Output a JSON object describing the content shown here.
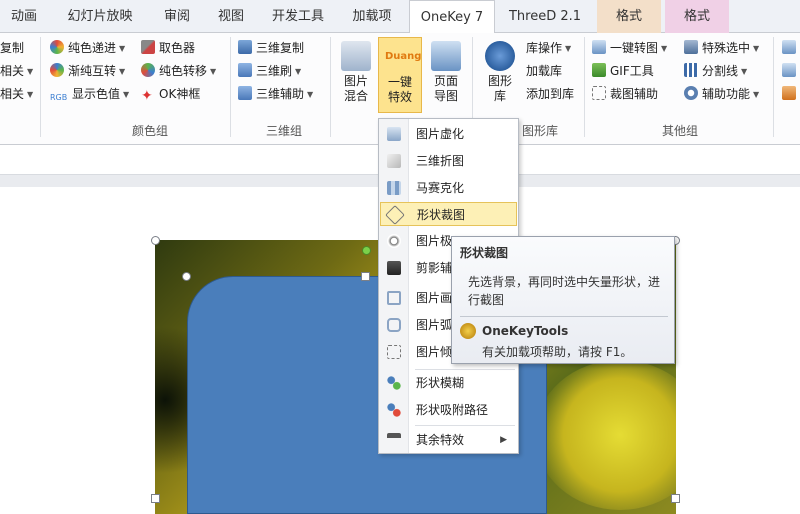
{
  "tabs": [
    {
      "label": "动画"
    },
    {
      "label": "幻灯片放映"
    },
    {
      "label": "审阅"
    },
    {
      "label": "视图"
    },
    {
      "label": "开发工具"
    },
    {
      "label": "加载项"
    },
    {
      "label": "OneKey 7"
    },
    {
      "label": "ThreeD 2.1"
    },
    {
      "label": "格式"
    },
    {
      "label": "格式"
    }
  ],
  "ribbon": {
    "partial_group": {
      "items": [
        "复制",
        "相关",
        "相关"
      ]
    },
    "color_group": {
      "label": "颜色组",
      "items": [
        "纯色递进",
        "渐纯互转",
        "显示色值",
        "取色器",
        "纯色转移",
        "OK神框"
      ]
    },
    "threed_group": {
      "label": "三维组",
      "items": [
        "三维复制",
        "三维刷",
        "三维辅助"
      ]
    },
    "image_group": {
      "buttons": [
        "图片混合",
        "一键特效",
        "页面导图"
      ],
      "badge": "Duang"
    },
    "shape_group": {
      "label": "图形库",
      "button": "图形库",
      "items": [
        "库操作",
        "加载库",
        "添加到库"
      ]
    },
    "other_group": {
      "label": "其他组",
      "items": [
        "一键转图",
        "GIF工具",
        "裁图辅助",
        "特殊选中",
        "分割线",
        "辅助功能"
      ]
    }
  },
  "dropdown": {
    "items": [
      "图片虚化",
      "三维折图",
      "马赛克化",
      "形状裁图",
      "图片极",
      "剪影辅",
      "图片画",
      "图片弧",
      "图片倾",
      "形状模糊",
      "形状吸附路径",
      "其余特效"
    ],
    "highlighted": "形状裁图"
  },
  "tooltip": {
    "title": "形状裁图",
    "body": "先选背景，再同时选中矢量形状，进行截图",
    "footer_title": "OneKeyTools",
    "footer_body": "有关加载项帮助，请按 F1。"
  },
  "colors": {
    "accent_active_button": "#fde38e",
    "shape_fill": "#4a7ebb",
    "tooltip_border": "#9aa1ad"
  }
}
